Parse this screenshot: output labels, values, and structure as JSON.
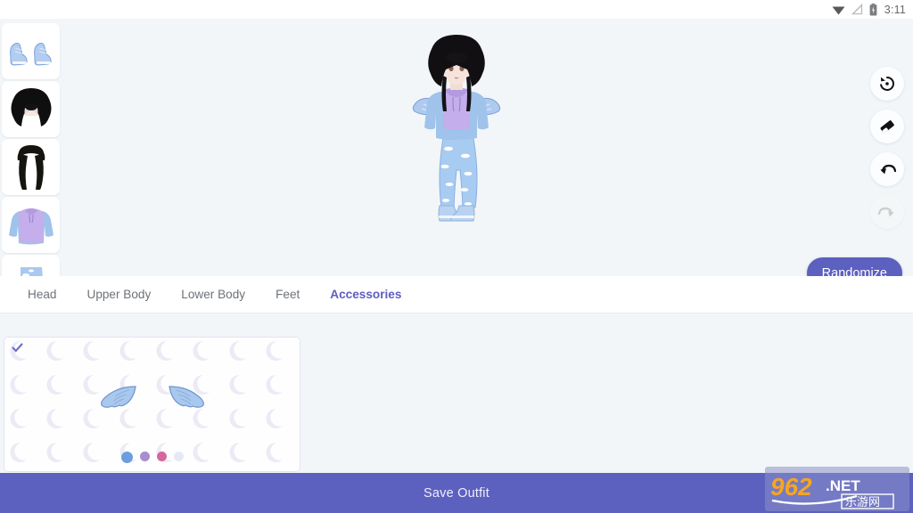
{
  "statusbar": {
    "time": "3:11",
    "icons": [
      "wifi-icon",
      "signal-off-icon",
      "battery-charging-icon"
    ]
  },
  "stage": {
    "background_color": "#f2f6f8",
    "character": {
      "name": "avatar-preview",
      "hair": "afro-black",
      "top": "hoodie-lavender-blue-sleeves",
      "bottom": "cloud-print-sweatpants",
      "shoes": "blue-sneakers",
      "accessory": "blue-angel-wings"
    },
    "rail_items": [
      {
        "name": "thumb-sneakers",
        "label": "Blue Sneakers"
      },
      {
        "name": "thumb-afro-hair",
        "label": "Afro Hair"
      },
      {
        "name": "thumb-long-hair",
        "label": "Long Straight Hair"
      },
      {
        "name": "thumb-hoodie",
        "label": "Lavender Hoodie"
      },
      {
        "name": "thumb-cloud-pants",
        "label": "Cloud Print Pants"
      }
    ],
    "tools": [
      {
        "name": "reset-button",
        "icon": "restore-icon",
        "disabled": false
      },
      {
        "name": "eraser-button",
        "icon": "eraser-icon",
        "disabled": false
      },
      {
        "name": "undo-button",
        "icon": "undo-icon",
        "disabled": false
      },
      {
        "name": "redo-button",
        "icon": "redo-icon",
        "disabled": true
      }
    ],
    "randomize_label": "Randomize"
  },
  "tabs": [
    {
      "label": "Head",
      "active": false
    },
    {
      "label": "Upper Body",
      "active": false
    },
    {
      "label": "Lower Body",
      "active": false
    },
    {
      "label": "Feet",
      "active": false
    },
    {
      "label": "Accessories",
      "active": true
    }
  ],
  "items": {
    "selected_item": {
      "name": "angel-wings",
      "selected": true,
      "swatches": [
        {
          "name": "swatch-blue",
          "color": "#6c9ede",
          "selected": true
        },
        {
          "name": "swatch-purple",
          "color": "#a98dce"
        },
        {
          "name": "swatch-pink",
          "color": "#d4689f"
        },
        {
          "name": "swatch-white",
          "color": "#e6e9f4"
        }
      ]
    }
  },
  "footer": {
    "save_label": "Save Outfit"
  },
  "watermark": {
    "text": "962",
    "suffix": ".NET",
    "sub": "乐游网"
  },
  "colors": {
    "accent": "#5c60bf",
    "accent_text": "#5c5ec0",
    "app_bg": "#f2f6f8",
    "card_bg": "#fefeff",
    "tab_inactive": "#6d7278"
  }
}
